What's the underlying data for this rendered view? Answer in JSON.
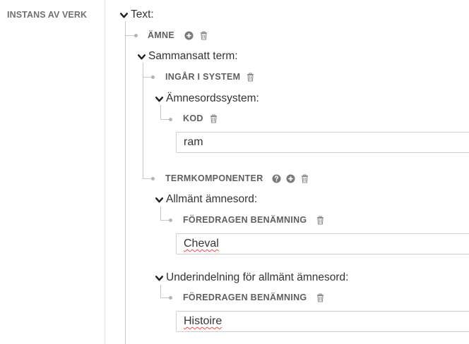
{
  "sidebar": {
    "label": "INSTANS AV VERK"
  },
  "tree": {
    "text_heading": "Text:",
    "amne_label": "ÄMNE",
    "sammansatt_heading": "Sammansatt term:",
    "ingar_label": "INGÅR I SYSTEM",
    "amnesordssystem_heading": "Ämnesordssystem:",
    "kod_label": "KOD",
    "kod_value": "ram",
    "termkomponenter_label": "TERMKOMPONENTER",
    "allmant_heading": "Allmänt ämnesord:",
    "foredragen_label_1": "FÖREDRAGEN BENÄMNING",
    "foredragen_value_1": "Cheval",
    "underindelning_heading": "Underindelning för allmänt ämnesord:",
    "foredragen_label_2": "FÖREDRAGEN BENÄMNING",
    "foredragen_value_2": "Histoire"
  },
  "icons": {
    "chevron": "chevron-down-icon",
    "add": "plus-circle-icon",
    "delete": "trash-icon",
    "help": "question-circle-icon"
  },
  "colors": {
    "label_gray": "#5f5f5f",
    "connector": "#c6c6c6",
    "icon_gray": "#8c8c8c",
    "spellcheck": "#d9534f"
  }
}
